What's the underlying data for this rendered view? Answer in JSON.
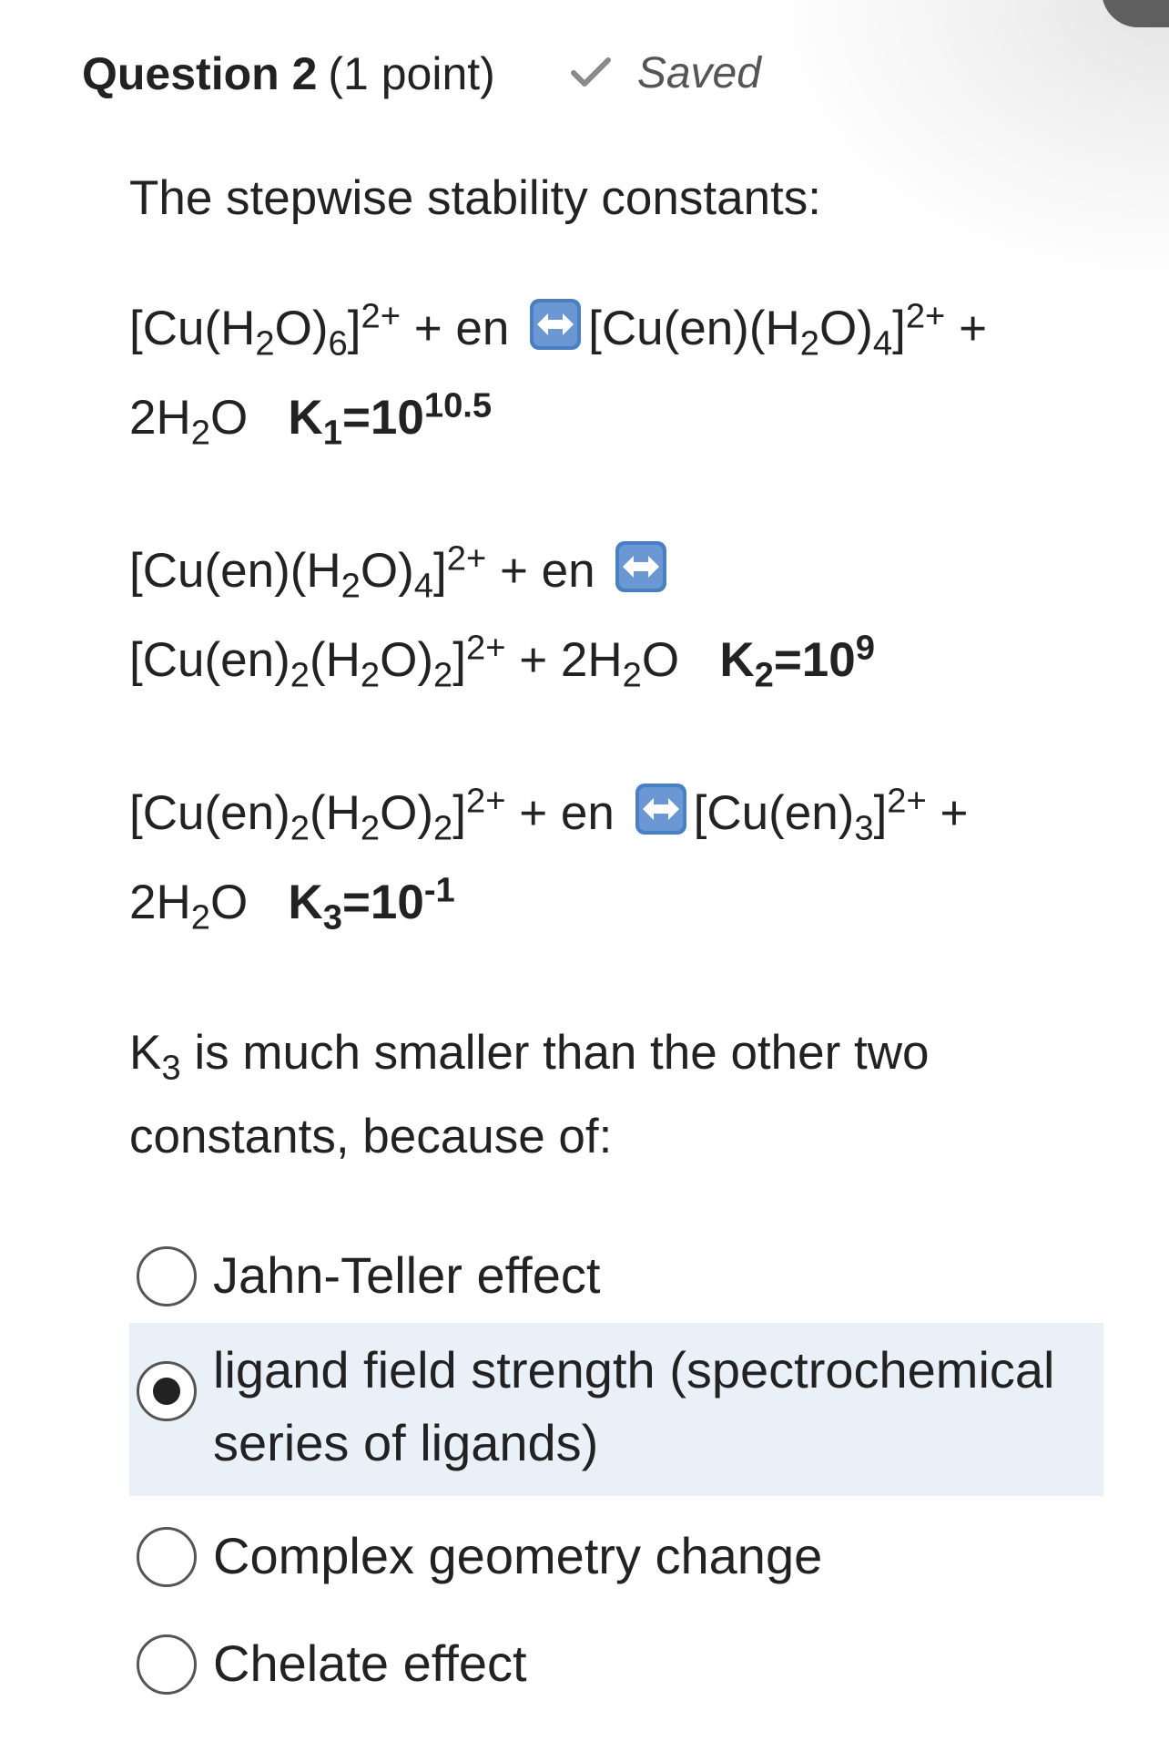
{
  "header": {
    "question_label": "Question 2",
    "points": "(1 point)",
    "status": "Saved"
  },
  "prompt": "The stepwise stability constants:",
  "equations": {
    "eq1": {
      "lhs_a": "[Cu(H",
      "lhs_b": "2",
      "lhs_c": "O)",
      "lhs_d": "6",
      "lhs_e": "]",
      "lhs_charge": "2+",
      "plus_en": " + en ",
      "rhs_a": "[Cu(en)(H",
      "rhs_b": "2",
      "rhs_c": "O)",
      "rhs_d": "4",
      "rhs_e": "]",
      "rhs_charge": "2+",
      "rhs_plus": " +",
      "water_a": "2H",
      "water_b": "2",
      "water_c": "O",
      "k_a": "K",
      "k_b": "1",
      "k_c": "=10",
      "k_exp": "10.5"
    },
    "eq2": {
      "lhs_a": "[Cu(en)(H",
      "lhs_b": "2",
      "lhs_c": "O)",
      "lhs_d": "4",
      "lhs_e": "]",
      "lhs_charge": "2+",
      "plus_en": " + en ",
      "rhs_a": "[Cu(en)",
      "rhs_b": "2",
      "rhs_c": "(H",
      "rhs_d": "2",
      "rhs_e": "O)",
      "rhs_f": "2",
      "rhs_g": "]",
      "rhs_charge": "2+",
      "water_a": " + 2H",
      "water_b": "2",
      "water_c": "O",
      "k_a": "K",
      "k_b": "2",
      "k_c": "=10",
      "k_exp": "9"
    },
    "eq3": {
      "lhs_a": "[Cu(en)",
      "lhs_b": "2",
      "lhs_c": "(H",
      "lhs_d": "2",
      "lhs_e": "O)",
      "lhs_f": "2",
      "lhs_g": "]",
      "lhs_charge": "2+",
      "plus_en": " + en ",
      "rhs_a": "[Cu(en)",
      "rhs_b": "3",
      "rhs_c": "]",
      "rhs_charge": "2+",
      "rhs_plus": " +",
      "water_a": "2H",
      "water_b": "2",
      "water_c": "O",
      "k_a": "K",
      "k_b": "3",
      "k_c": "=10",
      "k_exp": "-1"
    }
  },
  "question": {
    "k_a": "K",
    "k_b": "3",
    "text": " is much smaller than the other two constants, because of:"
  },
  "options": [
    {
      "label": "Jahn-Teller effect",
      "selected": false
    },
    {
      "label": "ligand field strength (spectrochemical series of ligands)",
      "selected": true
    },
    {
      "label": "Complex geometry change",
      "selected": false
    },
    {
      "label": "Chelate effect",
      "selected": false
    }
  ],
  "icons": {
    "status": "checkmark-icon",
    "equilibrium": "left-right-arrow-icon",
    "arrow_color": "#4a7fc1"
  }
}
